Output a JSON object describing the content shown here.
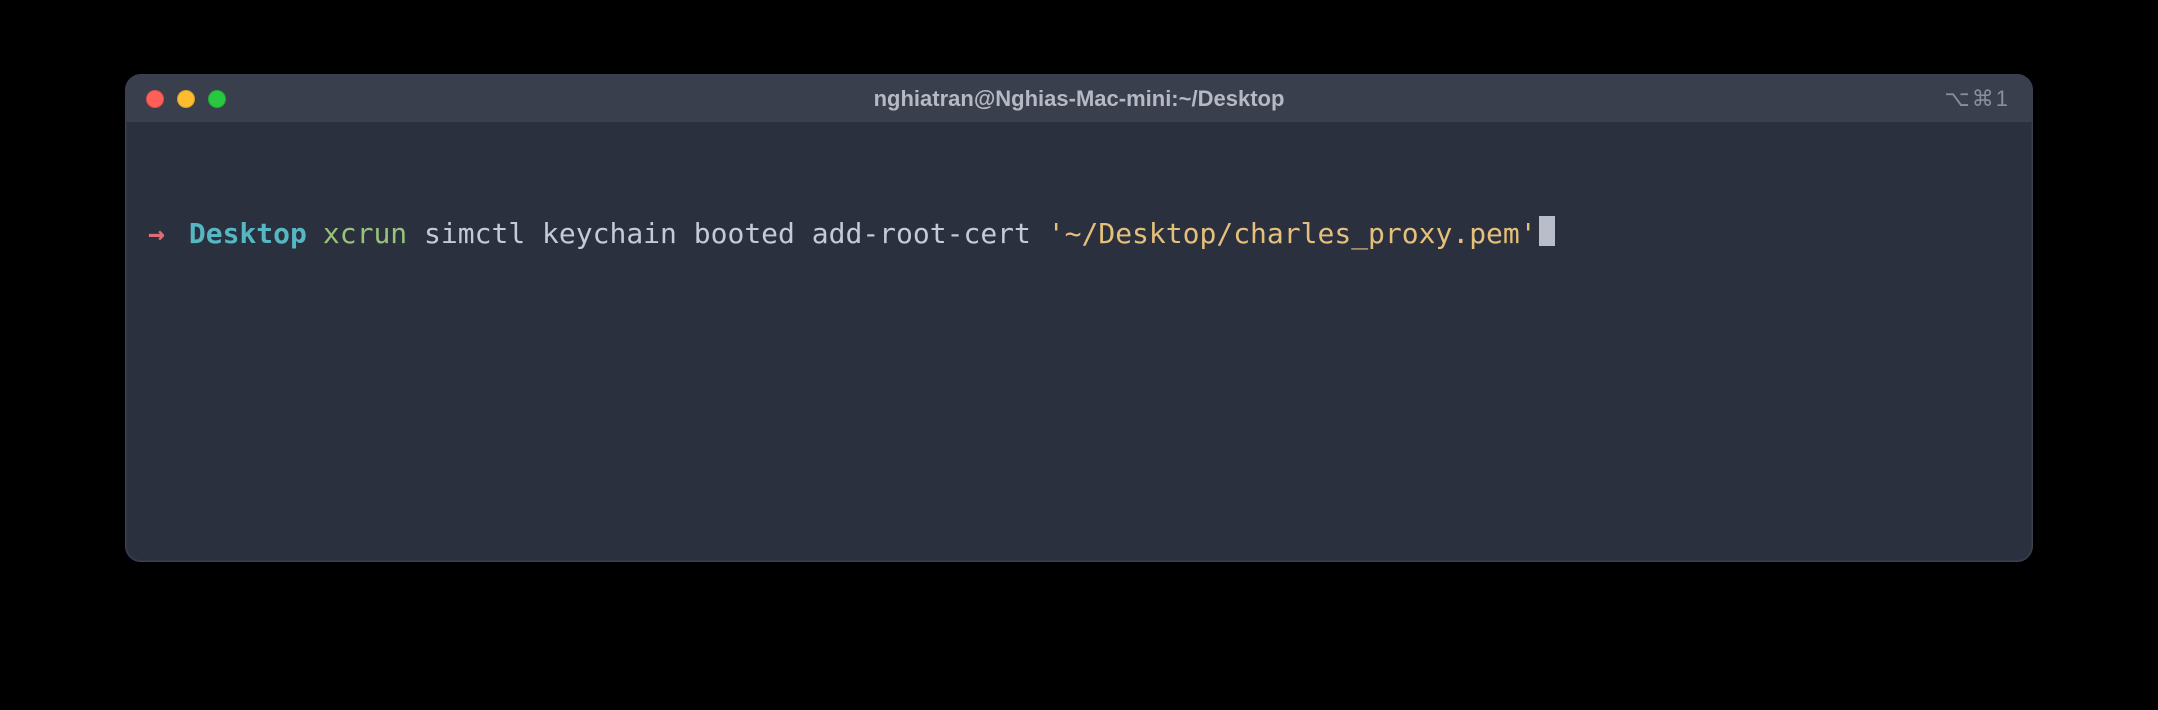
{
  "window": {
    "title": "nghiatran@Nghias-Mac-mini:~/Desktop",
    "shortcut_indicator": "⌥⌘1"
  },
  "prompt": {
    "arrow": "→",
    "cwd": "Desktop",
    "command": "xcrun",
    "args_plain": " simctl keychain booted add-root-cert ",
    "args_string": "'~/Desktop/charles_proxy.pem'"
  }
}
